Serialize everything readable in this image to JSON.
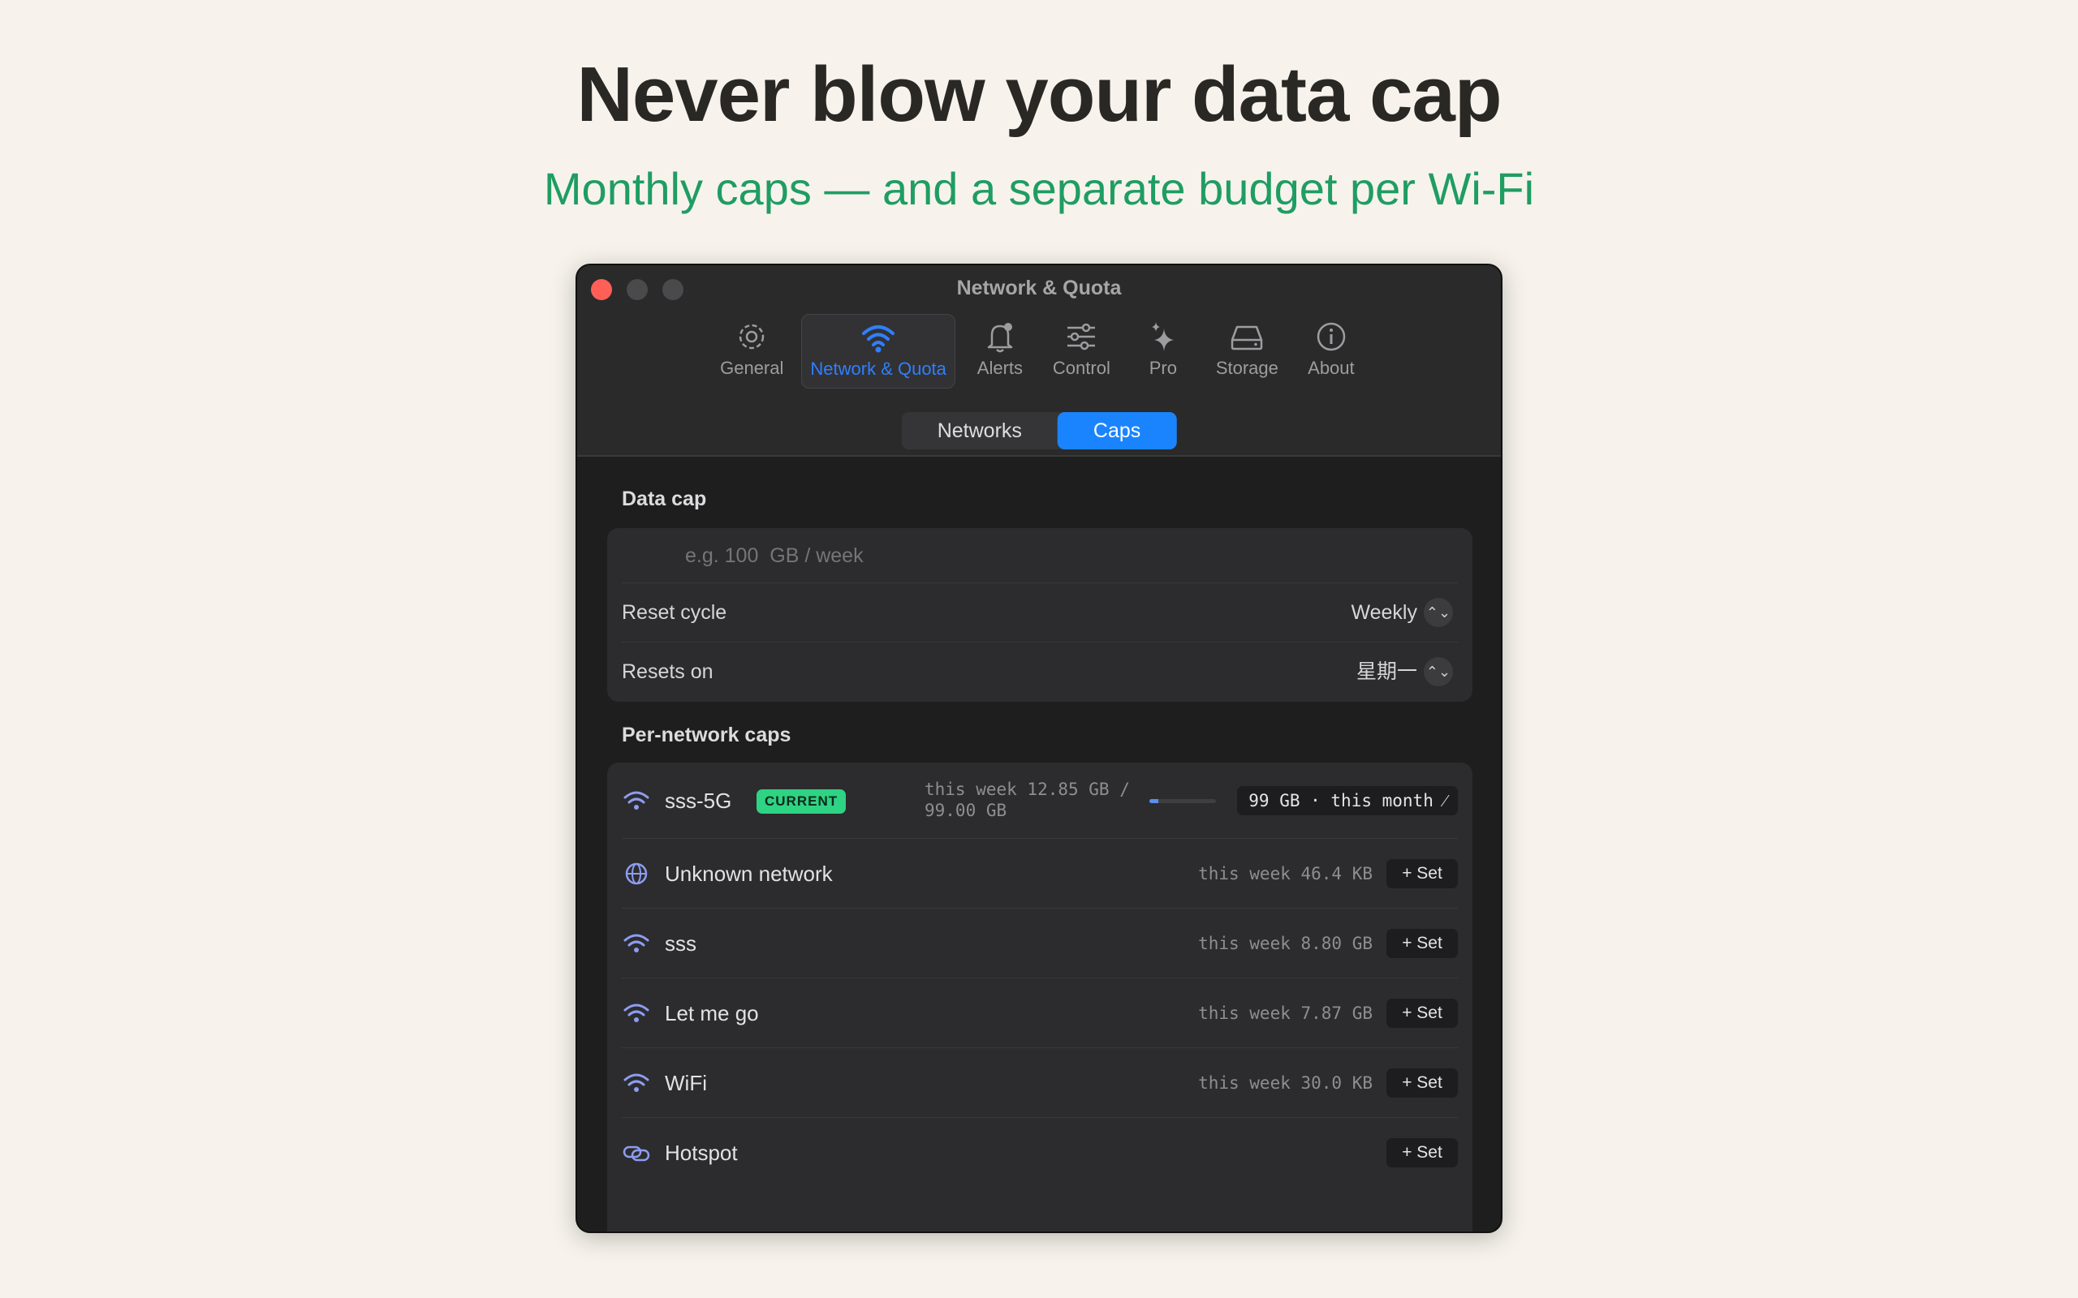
{
  "headline": "Never blow your data cap",
  "subhead": "Monthly caps — and a separate budget per Wi-Fi",
  "window": {
    "title": "Network & Quota",
    "toolbar": [
      {
        "label": "General",
        "icon": "gear-icon"
      },
      {
        "label": "Network & Quota",
        "icon": "wifi-icon",
        "active": true
      },
      {
        "label": "Alerts",
        "icon": "bell-icon"
      },
      {
        "label": "Control",
        "icon": "sliders-icon"
      },
      {
        "label": "Pro",
        "icon": "sparkle-icon"
      },
      {
        "label": "Storage",
        "icon": "drive-icon"
      },
      {
        "label": "About",
        "icon": "info-icon"
      }
    ],
    "segments": {
      "networks": "Networks",
      "caps": "Caps",
      "selected": "Caps"
    },
    "accent_color": "#1a84ff",
    "badge_color": "#2ed383"
  },
  "data_cap": {
    "section_label": "Data cap",
    "input_placeholder": "e.g. 100  GB / week",
    "reset_cycle_label": "Reset cycle",
    "reset_cycle_value": "Weekly",
    "resets_on_label": "Resets on",
    "resets_on_value": "星期一"
  },
  "per_network": {
    "section_label": "Per-network caps",
    "networks": [
      {
        "name": "sss-5G",
        "icon": "wifi-icon",
        "badge": "CURRENT",
        "usage_line1": "this week 12.85 GB /",
        "usage_line2": "99.00 GB",
        "progress": 0.13,
        "cap_chip": "99 GB · this month ⁄"
      },
      {
        "name": "Unknown network",
        "icon": "globe-icon",
        "usage": "this week 46.4 KB",
        "action": "+ Set"
      },
      {
        "name": "sss",
        "icon": "wifi-icon",
        "usage": "this week 8.80 GB",
        "action": "+ Set"
      },
      {
        "name": "Let me go",
        "icon": "wifi-icon",
        "usage": "this week 7.87 GB",
        "action": "+ Set"
      },
      {
        "name": "WiFi",
        "icon": "wifi-icon",
        "usage": "this week 30.0 KB",
        "action": "+ Set"
      },
      {
        "name": "Hotspot",
        "icon": "link-icon",
        "usage": "",
        "action": "+ Set"
      }
    ]
  }
}
